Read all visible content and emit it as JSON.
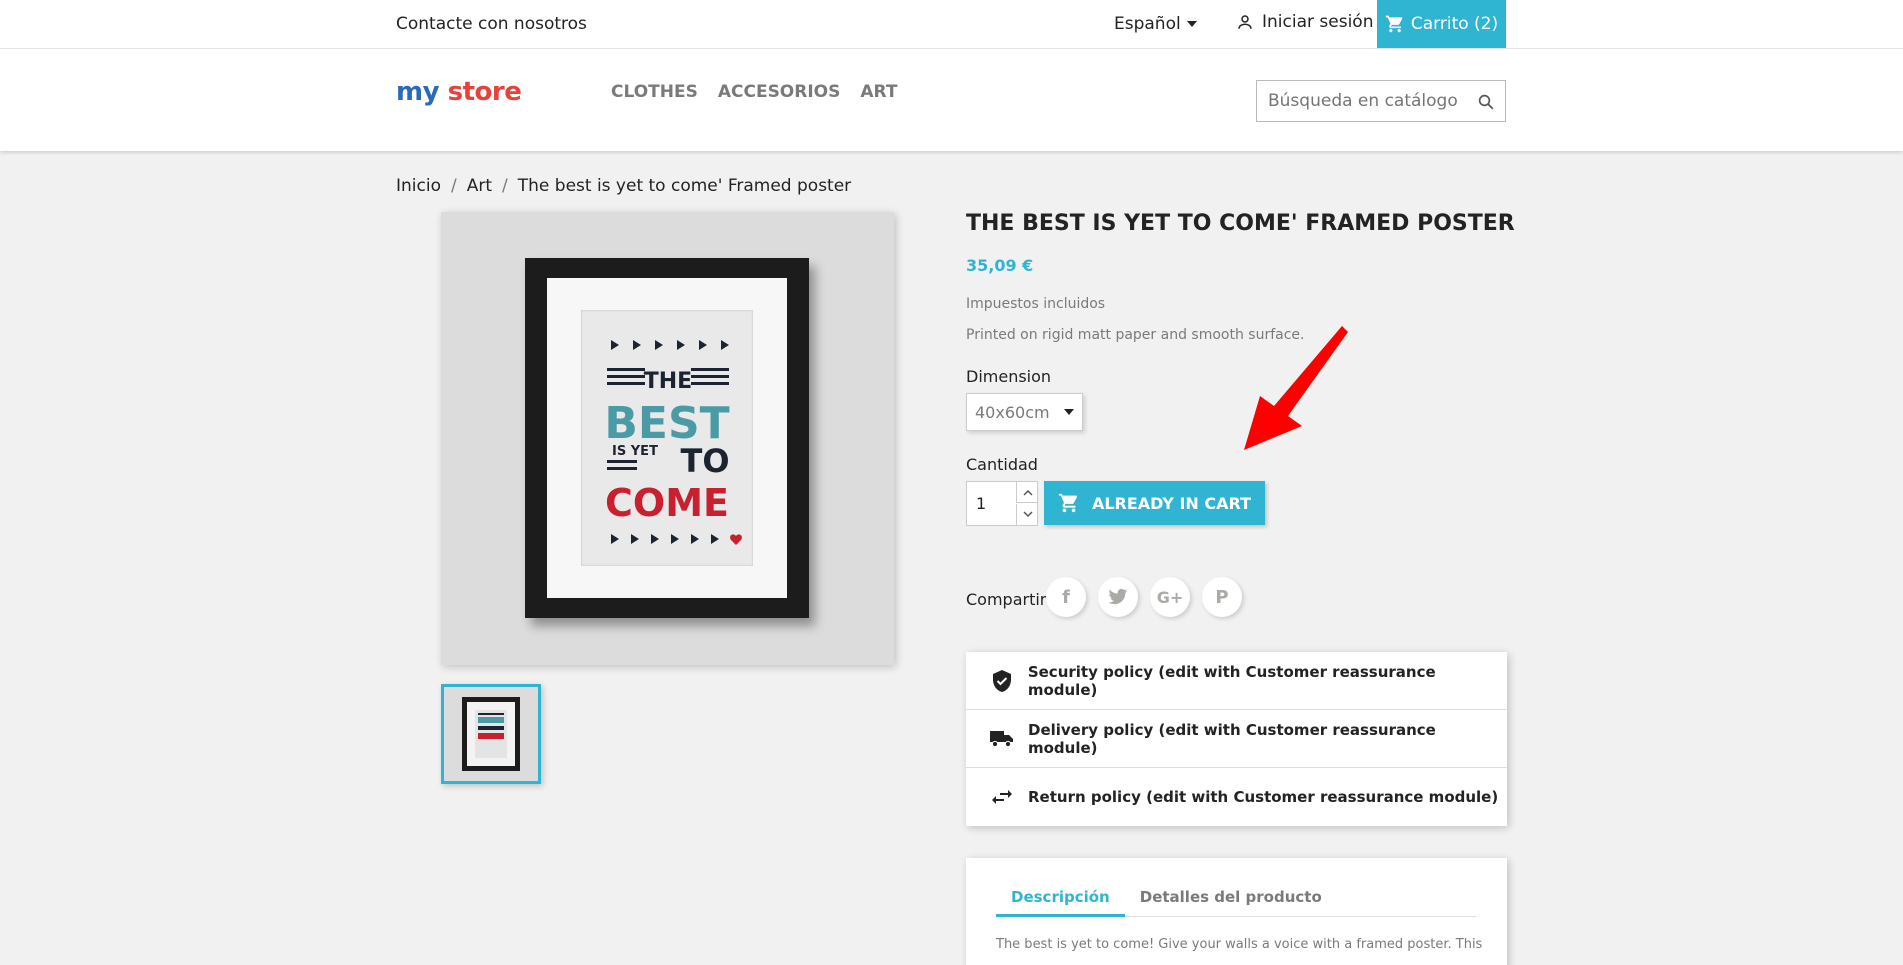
{
  "topbar": {
    "contact": "Contacte con nosotros",
    "language": "Español",
    "signin": "Iniciar sesión",
    "cart": "Carrito (2)"
  },
  "header": {
    "logo": {
      "part1": "my",
      "part2": "store"
    },
    "nav": [
      "CLOTHES",
      "ACCESORIOS",
      "ART"
    ],
    "search_placeholder": "Búsqueda en catálogo"
  },
  "breadcrumb": [
    "Inicio",
    "Art",
    "The best is yet to come' Framed poster"
  ],
  "poster": {
    "line1": "THE",
    "line2": "BEST",
    "line3": "IS YET",
    "line4": "TO",
    "line5": "COME"
  },
  "product": {
    "title": "THE BEST IS YET TO COME' FRAMED POSTER",
    "price": "35,09 €",
    "tax_label": "Impuestos incluidos",
    "short_desc": "Printed on rigid matt paper and smooth surface.",
    "dimension_label": "Dimension",
    "dimension_value": "40x60cm",
    "quantity_label": "Cantidad",
    "quantity_value": "1",
    "add_to_cart": "ALREADY IN CART",
    "share_label": "Compartir"
  },
  "reassurance": [
    {
      "icon": "shield-check-icon",
      "text": "Security policy (edit with Customer reassurance module)"
    },
    {
      "icon": "truck-icon",
      "text": "Delivery policy (edit with Customer reassurance module)"
    },
    {
      "icon": "swap-arrows-icon",
      "text": "Return policy (edit with Customer reassurance module)"
    }
  ],
  "tabs": {
    "items": [
      "Descripción",
      "Detalles del producto"
    ],
    "description": "The best is yet to come! Give your walls a voice with a framed poster. This"
  },
  "colors": {
    "accent": "#2fb5d2",
    "annotation_arrow": "#ff0000",
    "poster_teal": "#4a9ba6",
    "poster_red": "#c8202f"
  }
}
